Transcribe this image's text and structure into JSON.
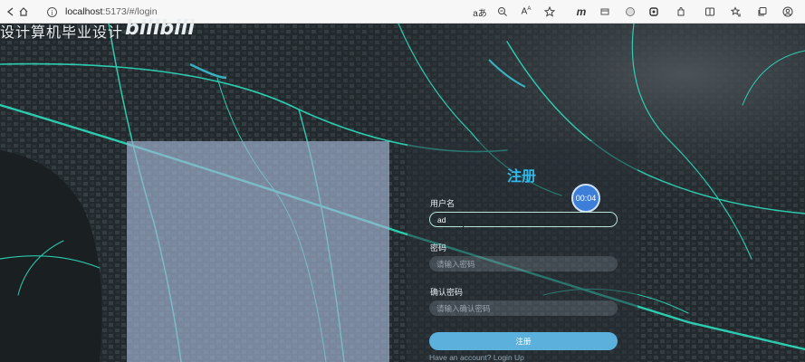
{
  "browser": {
    "url_host": "localhost",
    "url_path": ":5173/#/login",
    "icons": [
      "back-icon",
      "home-icon",
      "info-icon",
      "read-aloud-icon",
      "zoom-icon",
      "font-icon",
      "favorite-star-icon",
      "m-extension-icon",
      "extension-icon",
      "ai-icon",
      "shield-icon",
      "puzzle-icon",
      "split-screen-icon",
      "favorites-icon",
      "collections-icon",
      "profile-icon"
    ]
  },
  "watermark": {
    "text": "设计算机毕业设计",
    "logo": "bilibili"
  },
  "form": {
    "title": "注册",
    "timer": "00:04",
    "username_label": "用户名",
    "username_value": "ad",
    "password_label": "密码",
    "password_placeholder": "请输入密码",
    "confirm_label": "确认密码",
    "confirm_placeholder": "请输入确认密码",
    "submit_label": "注册",
    "login_link": "Have an account? Login Up"
  },
  "colors": {
    "accent": "#33b7e8",
    "button": "#5cb0dc",
    "map_road": "#2ee6c4"
  }
}
